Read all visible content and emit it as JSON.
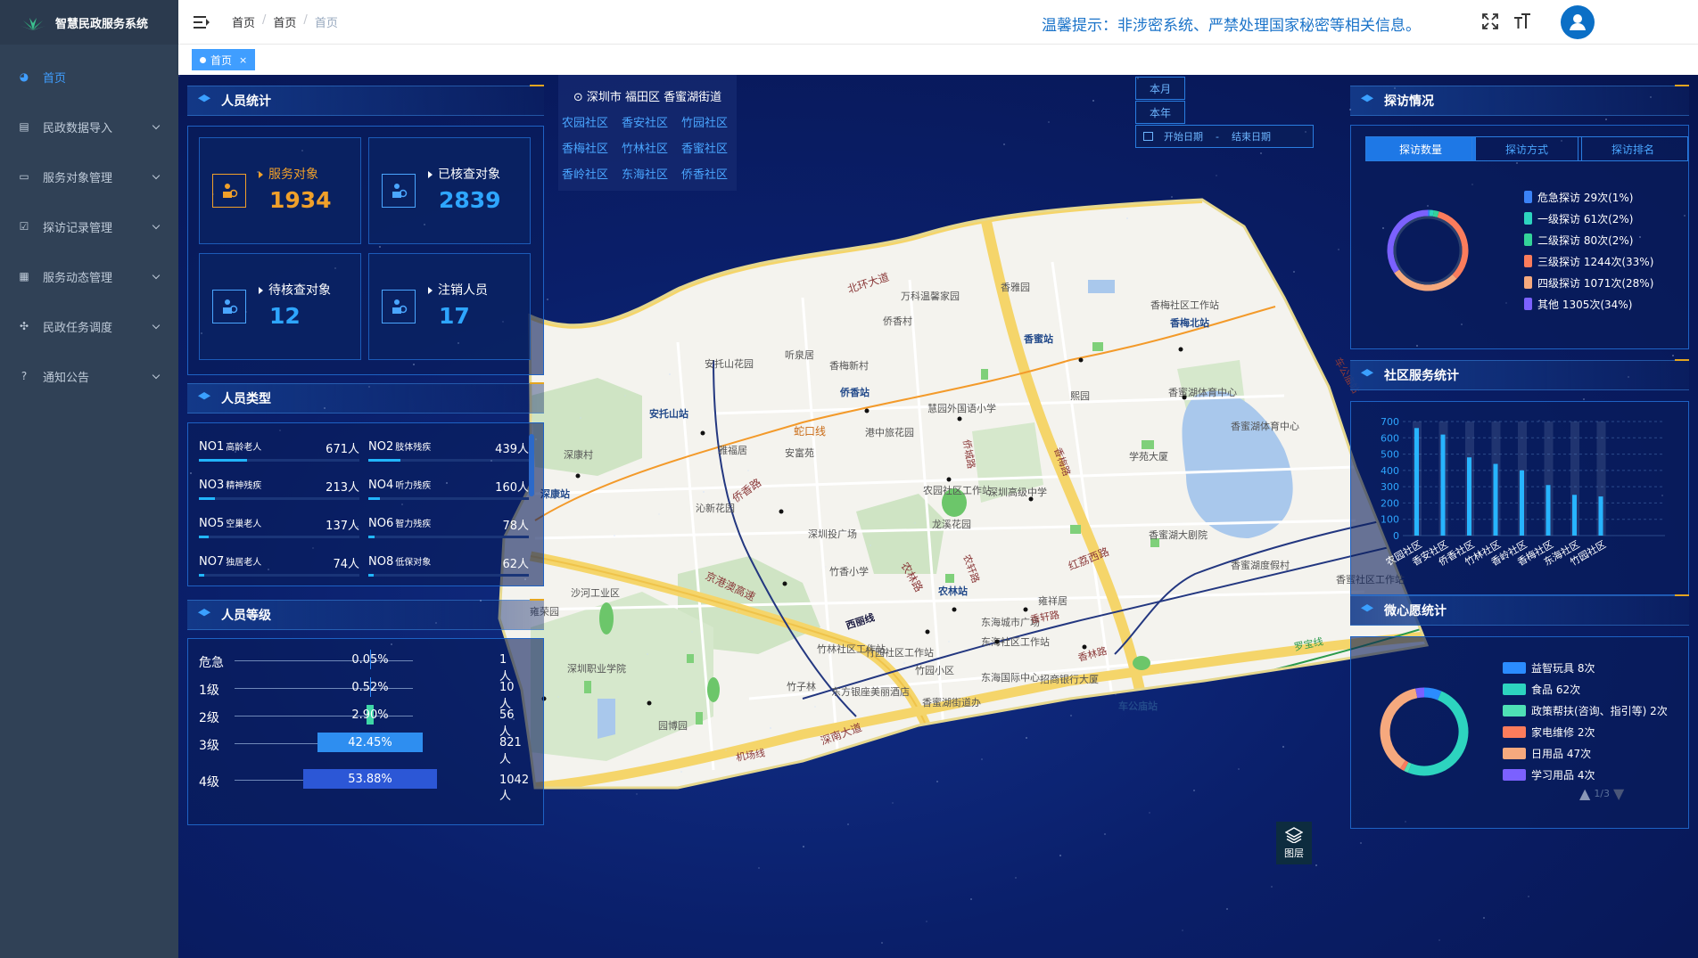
{
  "app": {
    "title": "智慧民政服务系统"
  },
  "sidebar": {
    "items": [
      {
        "label": "首页",
        "icon": "dashboard-icon",
        "active": true
      },
      {
        "label": "民政数据导入",
        "icon": "import-icon"
      },
      {
        "label": "服务对象管理",
        "icon": "target-icon"
      },
      {
        "label": "探访记录管理",
        "icon": "checkbox-icon"
      },
      {
        "label": "服务动态管理",
        "icon": "news-icon"
      },
      {
        "label": "民政任务调度",
        "icon": "dispatch-icon"
      },
      {
        "label": "通知公告",
        "icon": "question-icon"
      }
    ]
  },
  "header": {
    "breadcrumb": [
      "首页",
      "首页",
      "首页"
    ],
    "notice": "温馨提示：非涉密系统、严禁处理国家秘密等相关信息。"
  },
  "tags": {
    "active_tag": "首页"
  },
  "personnel_stats": {
    "title": "人员统计",
    "cards": [
      {
        "label": "服务对象",
        "value": "1934",
        "color": "#f0a02a"
      },
      {
        "label": "已核查对象",
        "value": "2839",
        "color": "#2ea6ff"
      },
      {
        "label": "待核查对象",
        "value": "12",
        "color": "#2ea6ff"
      },
      {
        "label": "注销人员",
        "value": "17",
        "color": "#2ea6ff"
      }
    ]
  },
  "personnel_types": {
    "title": "人员类型",
    "items": [
      {
        "no": "NO1",
        "name": "高龄老人",
        "value": "671人",
        "ratio": 0.3
      },
      {
        "no": "NO2",
        "name": "肢体残疾",
        "value": "439人",
        "ratio": 0.2
      },
      {
        "no": "NO3",
        "name": "精神残疾",
        "value": "213人",
        "ratio": 0.1
      },
      {
        "no": "NO4",
        "name": "听力残疾",
        "value": "160人",
        "ratio": 0.07
      },
      {
        "no": "NO5",
        "name": "空巢老人",
        "value": "137人",
        "ratio": 0.06
      },
      {
        "no": "NO6",
        "name": "智力残疾",
        "value": "78人",
        "ratio": 0.04
      },
      {
        "no": "NO7",
        "name": "独居老人",
        "value": "74人",
        "ratio": 0.035
      },
      {
        "no": "NO8",
        "name": "低保对象",
        "value": "62人",
        "ratio": 0.03
      }
    ]
  },
  "personnel_levels": {
    "title": "人员等级",
    "items": [
      {
        "name": "危急",
        "percent": "0.05%",
        "count": "1人",
        "ratio": 0.0005,
        "color": "#2b8cff"
      },
      {
        "name": "1级",
        "percent": "0.52%",
        "count": "10人",
        "ratio": 0.0052,
        "color": "#2b8cff"
      },
      {
        "name": "2级",
        "percent": "2.90%",
        "count": "56人",
        "ratio": 0.029,
        "color": "#3ed6a6"
      },
      {
        "name": "3级",
        "percent": "42.45%",
        "count": "821人",
        "ratio": 0.4245,
        "color": "#2e8ef0"
      },
      {
        "name": "4级",
        "percent": "53.88%",
        "count": "1042人",
        "ratio": 0.5388,
        "color": "#2c57d6"
      }
    ]
  },
  "location": {
    "title": "深圳市 福田区 香蜜湖街道",
    "communities": [
      "农园社区",
      "香安社区",
      "竹园社区",
      "香梅社区",
      "竹林社区",
      "香蜜社区",
      "香岭社区",
      "东海社区",
      "侨香社区"
    ]
  },
  "date_filter": {
    "month": "本月",
    "year": "本年",
    "start_placeholder": "开始日期",
    "separator": "-",
    "end_placeholder": "结束日期"
  },
  "visits": {
    "title": "探访情况",
    "tabs": [
      "探访数量",
      "探访方式",
      "探访排名"
    ],
    "legend": [
      {
        "label": "危急探访 29次(1%)",
        "color": "#3b82f6",
        "value": 29
      },
      {
        "label": "一级探访 61次(2%)",
        "color": "#2dd4bf",
        "value": 61
      },
      {
        "label": "二级探访 80次(2%)",
        "color": "#34d399",
        "value": 80
      },
      {
        "label": "三级探访 1244次(33%)",
        "color": "#fb7c5c",
        "value": 1244
      },
      {
        "label": "四级探访 1071次(28%)",
        "color": "#f6a97e",
        "value": 1071
      },
      {
        "label": "其他 1305次(34%)",
        "color": "#7b61ff",
        "value": 1305
      }
    ]
  },
  "community_service": {
    "title": "社区服务统计",
    "chart_data": {
      "type": "bar",
      "categories": [
        "农园社区",
        "香安社区",
        "侨香社区",
        "竹林社区",
        "香岭社区",
        "香梅社区",
        "东海社区",
        "竹园社区"
      ],
      "values": [
        660,
        620,
        480,
        440,
        400,
        310,
        250,
        240
      ],
      "ylim": [
        0,
        700
      ],
      "yticks": [
        "0",
        "100",
        "200",
        "300",
        "400",
        "500",
        "600",
        "700"
      ]
    }
  },
  "wishes": {
    "title": "微心愿统计",
    "legend": [
      {
        "label": "益智玩具 8次",
        "color": "#2b8cff",
        "value": 8
      },
      {
        "label": "食品 62次",
        "color": "#2dd4bf",
        "value": 62
      },
      {
        "label": "政策帮扶(咨询、指引等) 2次",
        "color": "#4ee0b5",
        "value": 2
      },
      {
        "label": "家电维修 2次",
        "color": "#fb7c5c",
        "value": 2
      },
      {
        "label": "日用品 47次",
        "color": "#f6a97e",
        "value": 47
      },
      {
        "label": "学习用品 4次",
        "color": "#7b61ff",
        "value": 4
      }
    ],
    "pager": "1/3"
  },
  "map": {
    "layer_button": "图层",
    "labels": [
      "北环大道",
      "万科温馨家园",
      "侨香村",
      "香雅园",
      "香梅社区工作站",
      "香梅北站",
      "香蜜站",
      "安托山花园",
      "听泉居",
      "香梅新村",
      "安托山站",
      "侨香站",
      "慧园外国语小学",
      "熙园",
      "香蜜湖体育中心",
      "香蜜湖体育中心",
      "蛇口线",
      "港中旅花园",
      "雅福居",
      "安富苑",
      "学苑大厦",
      "农园社区工作站",
      "深圳高级中学",
      "沁新花园",
      "深圳投广场",
      "龙溪花园",
      "香蜜湖大剧院",
      "香蜜湖度假村",
      "香蜜社区工作站",
      "竹香小学",
      "深康站",
      "深康村",
      "侨香路",
      "京港澳高速",
      "沙河工业区",
      "农林站",
      "红荔西路",
      "雍祥居",
      "东海城市广场",
      "东海社区工作站",
      "香轩路",
      "雍荣园",
      "深圳职业学院",
      "竹林社区工作站",
      "竹园社区工作站",
      "竹园小区",
      "竹子林",
      "东方银座美丽酒店",
      "东海国际中心",
      "招商银行大厦",
      "香林路",
      "车公庙站",
      "罗宝线",
      "西丽线",
      "机场线",
      "深南大道",
      "园博园",
      "香蜜湖街道办",
      "农林路",
      "农轩路",
      "侨城路",
      "香梅路",
      "车公庙站"
    ]
  }
}
